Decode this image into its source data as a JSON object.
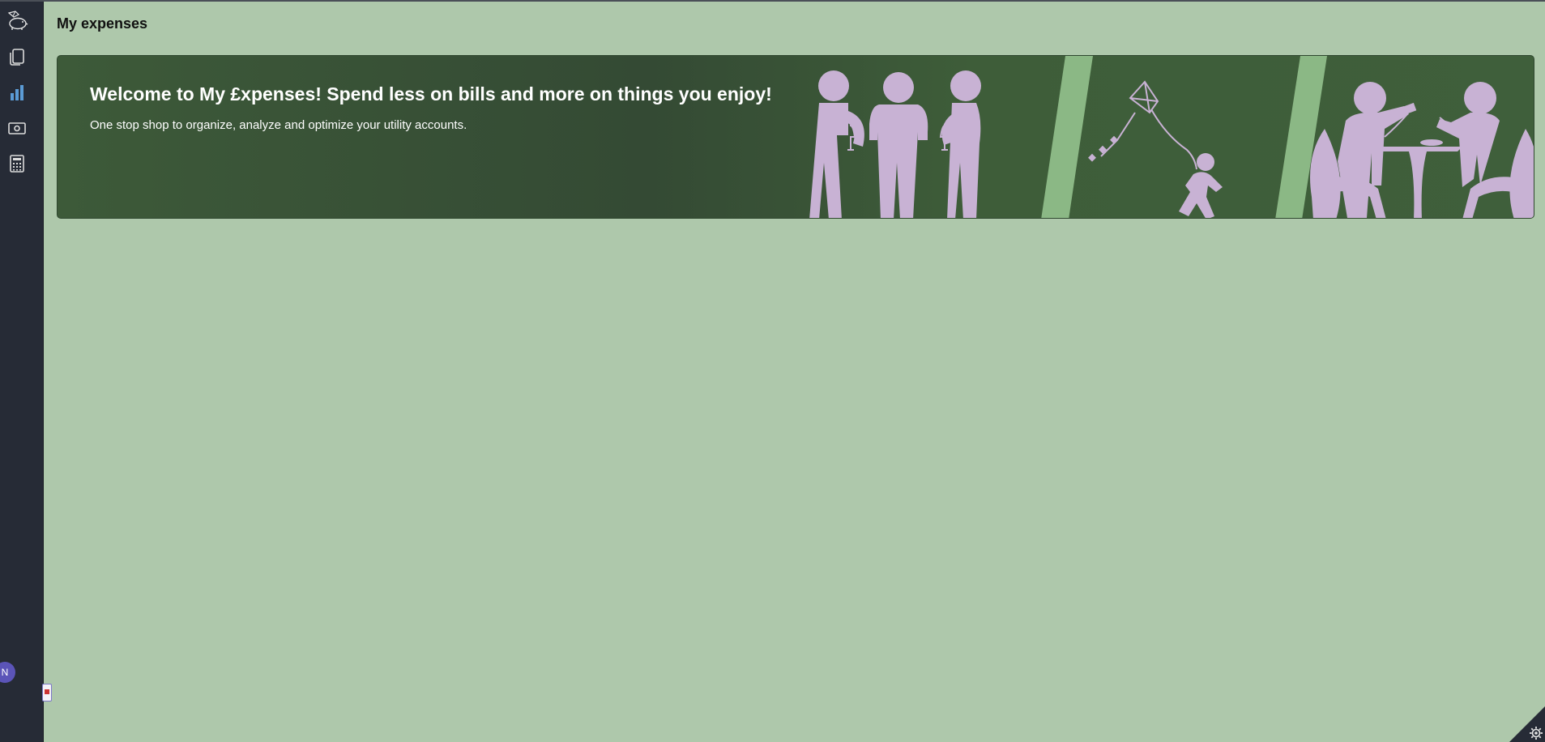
{
  "header": {
    "title": "My expenses"
  },
  "sidebar": {
    "items": [
      {
        "icon": "piggy-bank-icon"
      },
      {
        "icon": "documents-icon"
      },
      {
        "icon": "bar-chart-icon"
      },
      {
        "icon": "cash-icon"
      },
      {
        "icon": "calculator-icon"
      }
    ],
    "avatar_initial": "N"
  },
  "banner": {
    "title": "Welcome to My £xpenses! Spend less on bills and more on things you enjoy!",
    "subtitle": "One stop shop to organize, analyze and optimize your utility accounts."
  },
  "colors": {
    "background": "#aec8ab",
    "sidebar": "#262b36",
    "banner": "#3d5a39",
    "figures": "#c8b2d4",
    "stripes": "#8bb885",
    "accent": "#5b9bd5",
    "avatar": "#5b54b8"
  }
}
